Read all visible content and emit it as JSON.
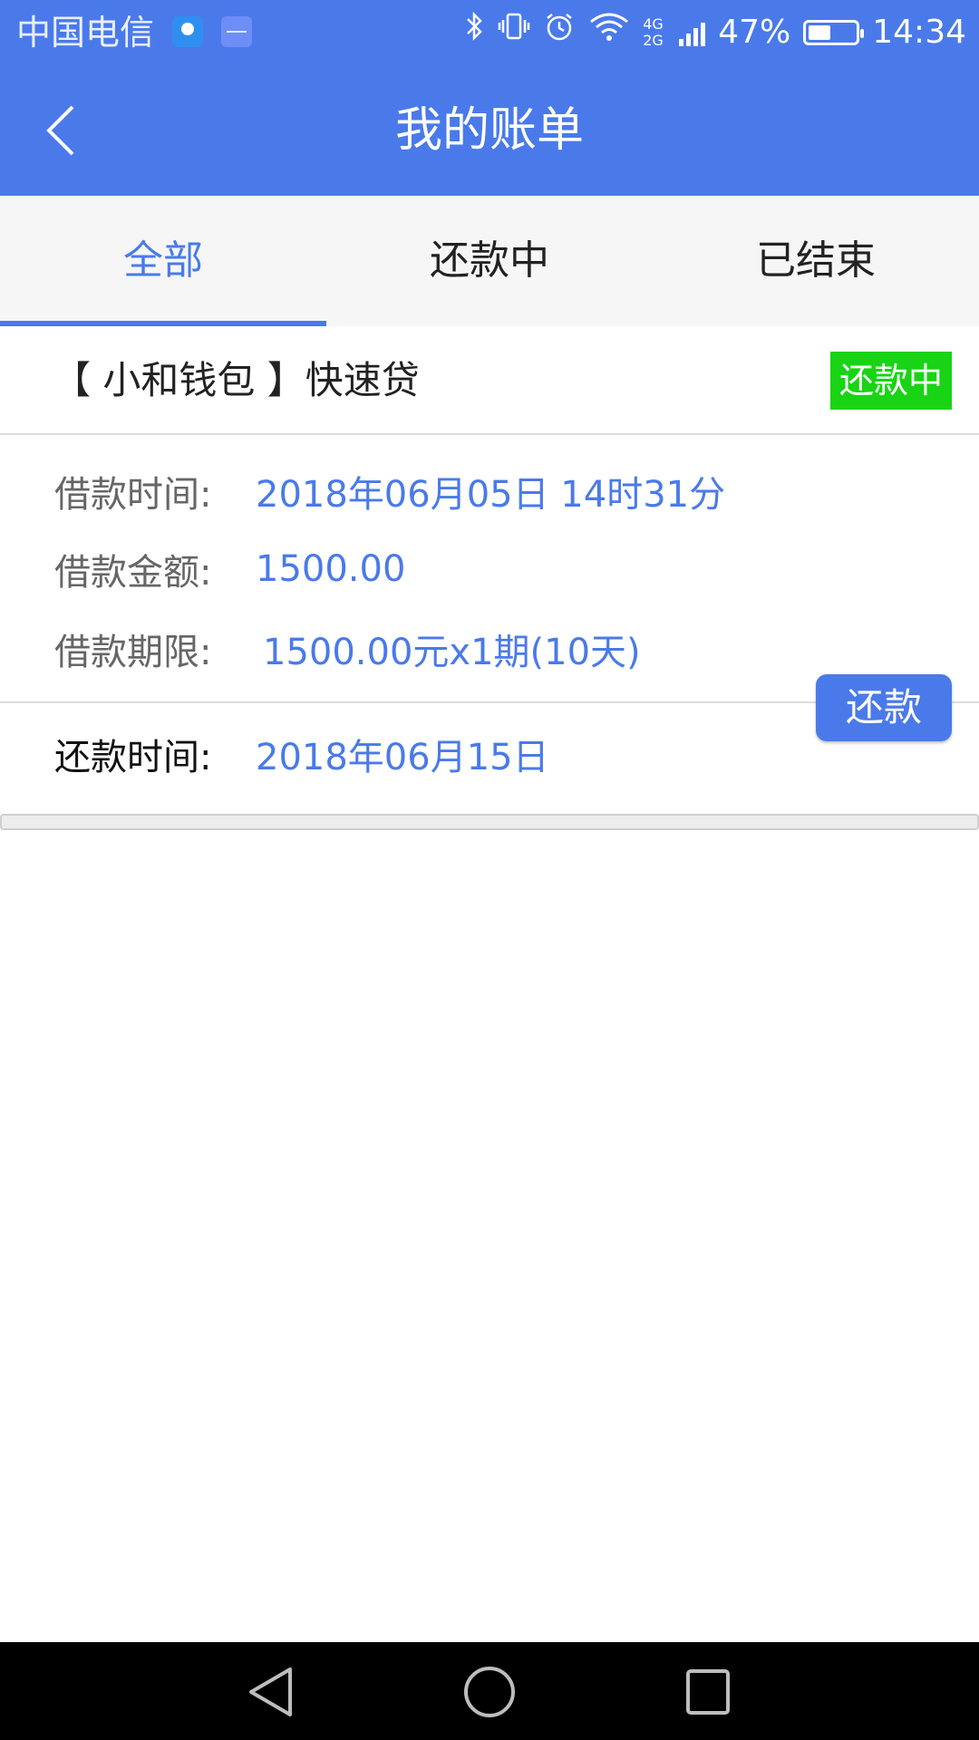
{
  "status_bar": {
    "carrier": "中国电信",
    "network": "4G 2G",
    "battery_percent": "47%",
    "battery_level": 0.47,
    "time": "14:34",
    "icons": [
      "map-app-icon",
      "health-app-icon",
      "bluetooth-icon",
      "vibrate-icon",
      "alarm-icon",
      "wifi-icon",
      "signal-icon",
      "battery-icon"
    ]
  },
  "header": {
    "title": "我的账单",
    "back_icon": "chevron-left-icon"
  },
  "tabs": [
    {
      "label": "全部",
      "active": true
    },
    {
      "label": "还款中",
      "active": false
    },
    {
      "label": "已结束",
      "active": false
    }
  ],
  "loan": {
    "product": "【 小和钱包 】快速贷",
    "status": "还款中",
    "details": [
      {
        "label": "借款时间:",
        "value": "2018年06月05日 14时31分"
      },
      {
        "label": "借款金额:",
        "value": "1500.00"
      },
      {
        "label": "借款期限:",
        "value": "1500.00元x1期(10天)"
      }
    ],
    "repay_label": "还款时间:",
    "repay_date": "2018年06月15日",
    "repay_button": "还款"
  },
  "colors": {
    "primary": "#4a7aea",
    "status_green": "#18d414",
    "label_gray": "#666666",
    "nav_black": "#000000"
  },
  "nav_bar": {
    "icons": [
      "back-triangle-icon",
      "home-circle-icon",
      "recent-square-icon"
    ]
  }
}
